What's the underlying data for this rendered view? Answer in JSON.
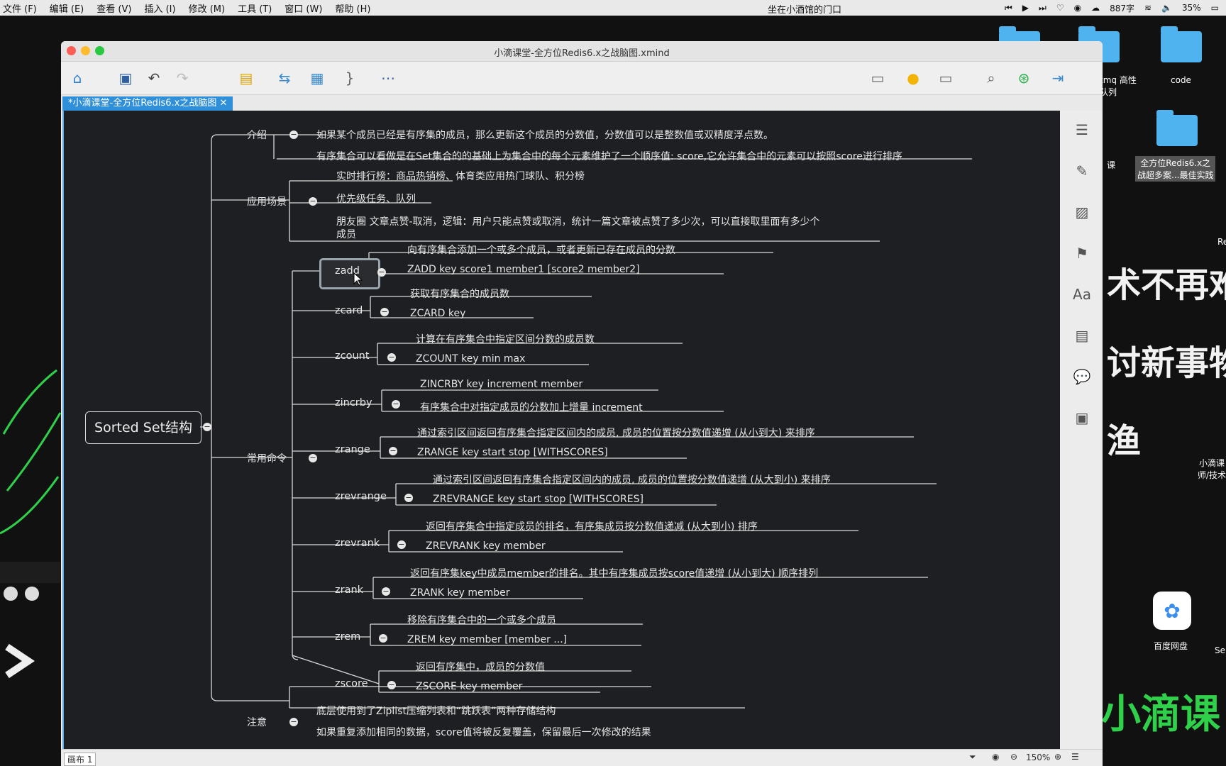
{
  "menubar": {
    "items": [
      "文件 (F)",
      "编辑 (E)",
      "查看 (V)",
      "插入 (I)",
      "修改 (M)",
      "工具 (T)",
      "窗口 (W)",
      "帮助 (H)"
    ],
    "center_title": "坐在小酒馆的门口",
    "word_count": "887字",
    "battery": "35%"
  },
  "desktop": {
    "big_text": [
      "术不再难",
      "讨新事物",
      "渔"
    ],
    "bottom_text": "小滴课",
    "labels": {
      "code": "code",
      "mq": "tmq 高性\n队列",
      "redis_file": "全方位Redis6.x之\n战超多案...最佳实践",
      "baidu": "百度网盘",
      "xiaodi": "小滴课\n师/技术",
      "re": "Re",
      "se": "Se",
      "ke": "课"
    }
  },
  "window": {
    "title": "小滴课堂-全方位Redis6.x之战脑图.xmind",
    "tab_label": "*小滴课堂-全方位Redis6.x之战脑图",
    "status_left": "画布 1",
    "zoom": "150%"
  },
  "mindmap": {
    "root": "Sorted Set结构",
    "branches": {
      "intro": {
        "label": "介绍",
        "items": [
          "如果某个成员已经是有序集的成员，那么更新这个成员的分数值，分数值可以是整数值或双精度浮点数。",
          "有序集合可以看做是在Set集合的的基础上为集合中的每个元素维护了一个顺序值: score,它允许集合中的元素可以按照score进行排序"
        ]
      },
      "scenarios": {
        "label": "应用场景",
        "items": [
          "实时排行榜：商品热销榜、体育类应用热门球队、积分榜",
          "优先级任务、队列",
          "朋友圈 文章点赞-取消，逻辑：用户只能点赞或取消，统计一篇文章被点赞了多少次，可以直接取里面有多少个",
          "成员"
        ]
      },
      "commands": {
        "label": "常用命令",
        "list": [
          {
            "name": "zadd",
            "desc": "向有序集合添加一个或多个成员，或者更新已存在成员的分数",
            "syntax": "ZADD key score1 member1 [score2 member2]"
          },
          {
            "name": "zcard",
            "desc": "获取有序集合的成员数",
            "syntax": "ZCARD key"
          },
          {
            "name": "zcount",
            "desc": "计算在有序集合中指定区间分数的成员数",
            "syntax": "ZCOUNT key min max"
          },
          {
            "name": "zincrby",
            "desc": "ZINCRBY key increment member",
            "syntax": "有序集合中对指定成员的分数加上增量 increment"
          },
          {
            "name": "zrange",
            "desc": "通过索引区间返回有序集合指定区间内的成员, 成员的位置按分数值递增 (从小到大) 来排序",
            "syntax": "ZRANGE key start stop [WITHSCORES]"
          },
          {
            "name": "zrevrange",
            "desc": "通过索引区间返回有序集合指定区间内的成员, 成员的位置按分数值递增 (从大到小) 来排序",
            "syntax": "ZREVRANGE key start stop [WITHSCORES]"
          },
          {
            "name": "zrevrank",
            "desc": "返回有序集合中指定成员的排名，有序集成员按分数值递减 (从大到小) 排序",
            "syntax": "ZREVRANK key member"
          },
          {
            "name": "zrank",
            "desc": "返回有序集key中成员member的排名。其中有序集成员按score值递增 (从小到大) 顺序排列",
            "syntax": "ZRANK key member"
          },
          {
            "name": "zrem",
            "desc": "移除有序集合中的一个或多个成员",
            "syntax": "ZREM key member [member ...]"
          },
          {
            "name": "zscore",
            "desc": "返回有序集中，成员的分数值",
            "syntax": "ZSCORE key member"
          }
        ]
      },
      "notes": {
        "label": "注意",
        "items": [
          "底层使用到了Ziplist压缩列表和“跳跃表”两种存储结构",
          "如果重复添加相同的数据，score值将被反复覆盖，保留最后一次修改的结果"
        ]
      }
    }
  },
  "colors": {
    "canvas_bg": "#1e1f22",
    "tab_blue": "#2f8fd8",
    "folder_blue": "#4fb3f0",
    "line": "#d9d9d9"
  }
}
